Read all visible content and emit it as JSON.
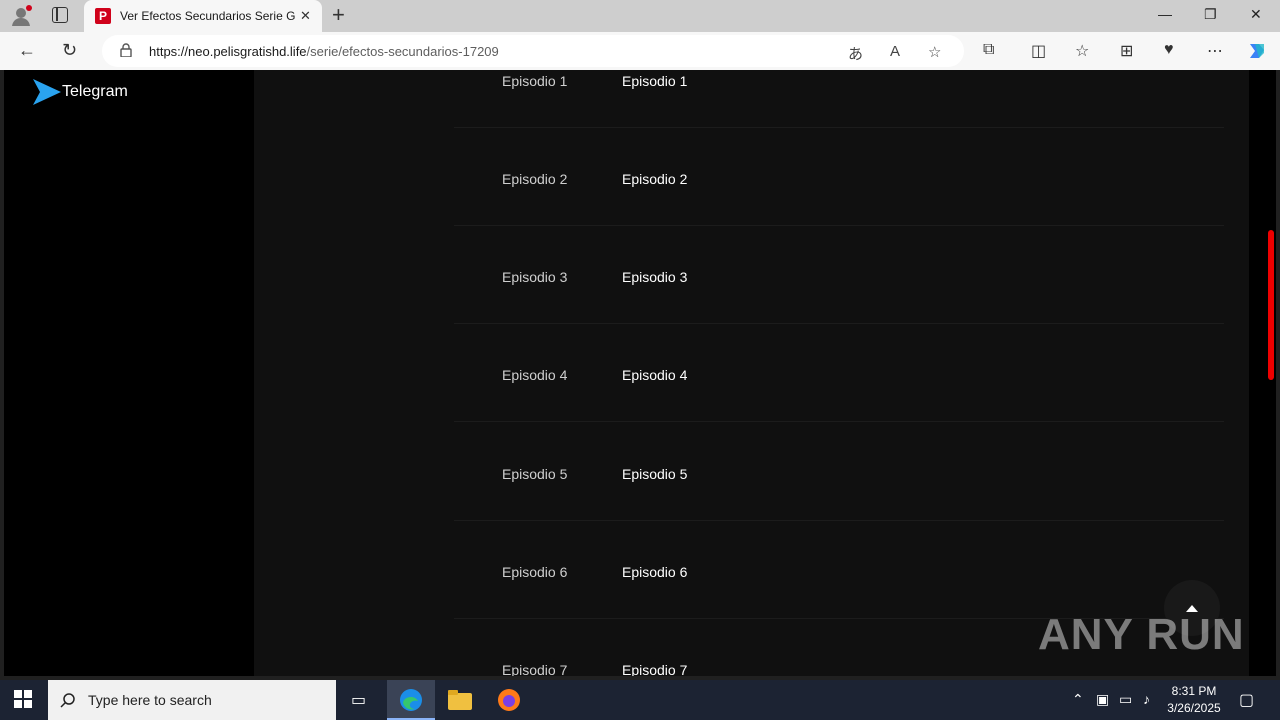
{
  "browser": {
    "tab_title": "Ver Efectos Secundarios Serie Gratis",
    "tab_favicon_letter": "P",
    "url_host": "https://neo.pelisgratishd.life",
    "url_path": "/serie/efectos-secundarios-17209"
  },
  "sidebar": {
    "telegram_label": "Telegram"
  },
  "episodes": [
    {
      "col1": "Episodio 1",
      "col2": "Episodio 1"
    },
    {
      "col1": "Episodio 2",
      "col2": "Episodio 2"
    },
    {
      "col1": "Episodio 3",
      "col2": "Episodio 3"
    },
    {
      "col1": "Episodio 4",
      "col2": "Episodio 4"
    },
    {
      "col1": "Episodio 5",
      "col2": "Episodio 5"
    },
    {
      "col1": "Episodio 6",
      "col2": "Episodio 6"
    },
    {
      "col1": "Episodio 7",
      "col2": "Episodio 7"
    }
  ],
  "watermark": "ANY RUN",
  "taskbar": {
    "search_placeholder": "Type here to search",
    "time": "8:31 PM",
    "date": "3/26/2025"
  },
  "colors": {
    "accent": "#e00000",
    "telegram_blue": "#2aa3ef"
  }
}
